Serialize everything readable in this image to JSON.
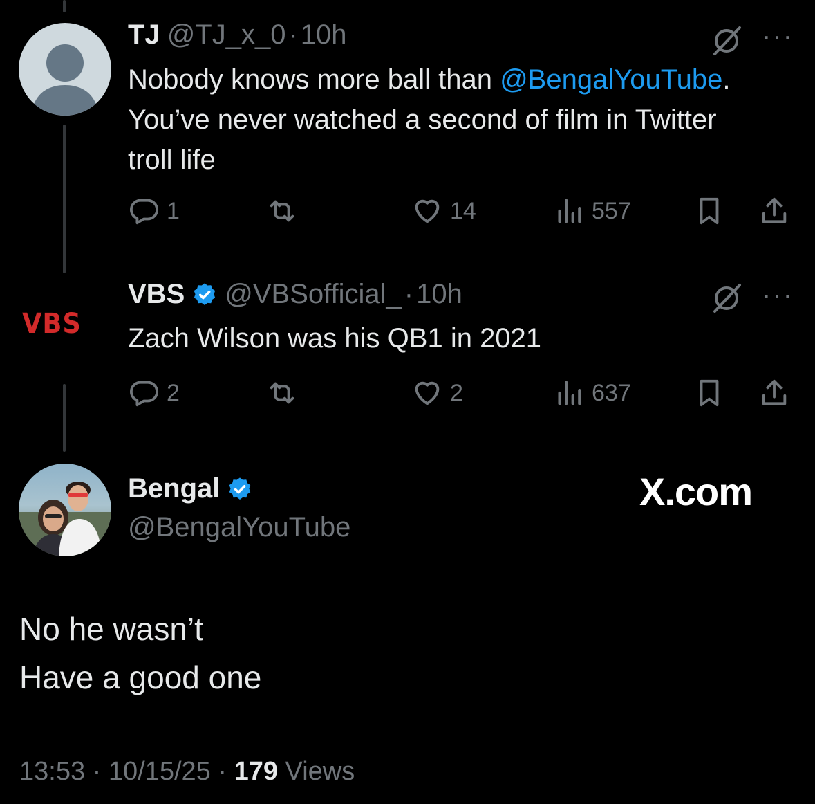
{
  "tweets": [
    {
      "name": "TJ",
      "handle": "@TJ_x_0",
      "sep": "·",
      "time": "10h",
      "text_before": "Nobody knows more ball than ",
      "mention": "@BengalYouTube",
      "text_after": ". You’ve never watched a second of film in Twitter troll life",
      "replies": "1",
      "likes": "14",
      "views": "557",
      "more": "···"
    },
    {
      "name": "VBS",
      "avatar_text": "VBS",
      "handle": "@VBSofficial_",
      "sep": "·",
      "time": "10h",
      "text": "Zach Wilson was his QB1 in 2021",
      "replies": "2",
      "likes": "2",
      "views": "637",
      "more": "···"
    }
  ],
  "main": {
    "name": "Bengal",
    "handle": "@BengalYouTube",
    "watermark": "X.com",
    "line1": "No he wasn’t",
    "line2": "Have a good one",
    "time": "13:53",
    "sep": "·",
    "date": "10/15/25",
    "views_count": "179",
    "views_label": "Views"
  },
  "colors": {
    "background": "#000000",
    "text": "#e7e9ea",
    "muted": "#71767b",
    "link": "#1d9bf0",
    "verified": "#1d9bf0",
    "vbs_red": "#d22a2a"
  }
}
